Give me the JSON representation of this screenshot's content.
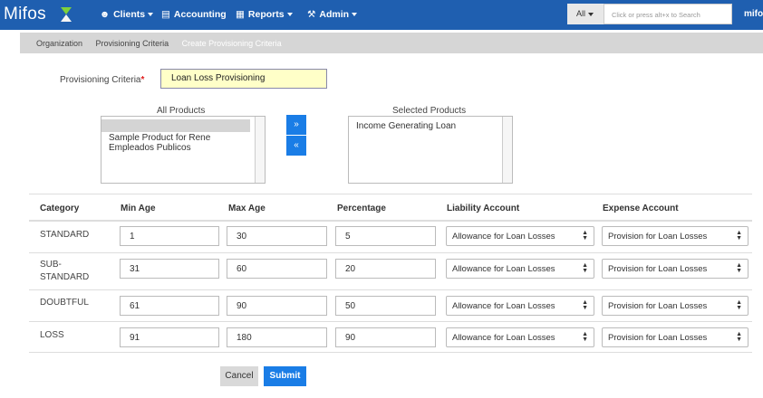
{
  "navbar": {
    "brand": "Mifos",
    "menus": [
      {
        "label": "Clients",
        "icon": "users-icon"
      },
      {
        "label": "Accounting",
        "icon": "money-icon"
      },
      {
        "label": "Reports",
        "icon": "bar-chart-icon"
      },
      {
        "label": "Admin",
        "icon": "wrench-icon"
      }
    ],
    "search_scope": "All",
    "search_placeholder": "Click or press alt+x to Search",
    "user": "mifo"
  },
  "breadcrumb": [
    "Organization",
    "Provisioning Criteria",
    "Create Provisioning Criteria"
  ],
  "form": {
    "criteria_label": "Provisioning Criteria",
    "required_mark": "*",
    "criteria_value": "Loan Loss Provisioning",
    "all_products_title": "All Products",
    "all_products": [
      "",
      "Sample Product for Rene",
      "Empleados Publicos"
    ],
    "selected_products_title": "Selected Products",
    "selected_products": [
      "Income Generating Loan"
    ],
    "add_button": "»",
    "remove_button": "«"
  },
  "table": {
    "headers": [
      "Category",
      "Min Age",
      "Max Age",
      "Percentage",
      "Liability Account",
      "Expense Account"
    ],
    "rows": [
      {
        "category": "STANDARD",
        "min": "1",
        "max": "30",
        "pct": "5",
        "liability": "Allowance for Loan Losses",
        "expense": "Provision for Loan Losses"
      },
      {
        "category": "SUB-\nSTANDARD",
        "min": "31",
        "max": "60",
        "pct": "20",
        "liability": "Allowance for Loan Losses",
        "expense": "Provision for Loan Losses"
      },
      {
        "category": "DOUBTFUL",
        "min": "61",
        "max": "90",
        "pct": "50",
        "liability": "Allowance for Loan Losses",
        "expense": "Provision for Loan Losses"
      },
      {
        "category": "LOSS",
        "min": "91",
        "max": "180",
        "pct": "90",
        "liability": "Allowance for Loan Losses",
        "expense": "Provision for Loan Losses"
      }
    ]
  },
  "actions": {
    "cancel": "Cancel",
    "submit": "Submit"
  },
  "colors": {
    "navbar": "#1f5fb0",
    "primary_button": "#1a7de6",
    "highlight_input": "#ffffc8",
    "required": "#e02020"
  }
}
